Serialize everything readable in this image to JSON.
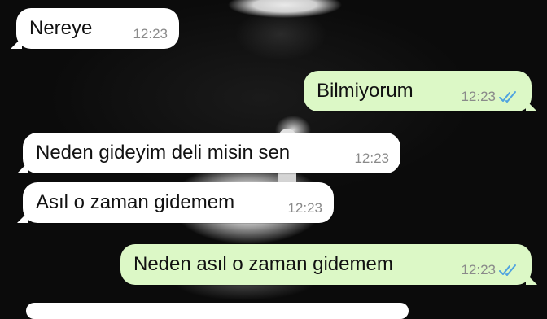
{
  "messages": [
    {
      "text": "Nereye",
      "time": "12:23",
      "direction": "incoming"
    },
    {
      "text": "Bilmiyorum",
      "time": "12:23",
      "direction": "outgoing",
      "status": "read"
    },
    {
      "text": "Neden gideyim deli misin sen",
      "time": "12:23",
      "direction": "incoming"
    },
    {
      "text": "Asıl o zaman gidemem",
      "time": "12:23",
      "direction": "incoming"
    },
    {
      "text": "Neden asıl o zaman gidemem",
      "time": "12:23",
      "direction": "outgoing",
      "status": "read"
    }
  ],
  "colors": {
    "incoming_bubble": "#ffffff",
    "outgoing_bubble": "#dcf8c6",
    "read_ticks": "#4fa3e0",
    "timestamp": "#8a8a8a"
  },
  "icons": {
    "read_receipt": "double-check-icon"
  }
}
